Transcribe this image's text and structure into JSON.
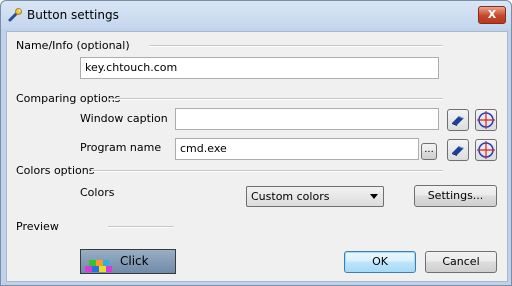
{
  "window": {
    "title": "Button settings",
    "close_glyph": "X"
  },
  "name_info": {
    "label": "Name/Info (optional)",
    "value": "key.chtouch.com"
  },
  "comparing": {
    "label": "Comparing options",
    "window_caption_label": "Window caption",
    "window_caption_value": "",
    "program_name_label": "Program name",
    "program_name_value": "cmd.exe",
    "browse_label": "..."
  },
  "colors_options": {
    "label": "Colors options",
    "colors_label": "Colors",
    "selected": "Custom colors",
    "settings_label": "Settings..."
  },
  "preview": {
    "label": "Preview",
    "button_text": "Click"
  },
  "buttons": {
    "ok": "OK",
    "cancel": "Cancel"
  },
  "icons": [
    "wrench-icon",
    "eraser-icon",
    "crosshair-icon"
  ],
  "colors": {
    "accent_red": "#c4472b",
    "crosshair_blue": "#1a3fbf",
    "crosshair_red": "#e02020"
  }
}
